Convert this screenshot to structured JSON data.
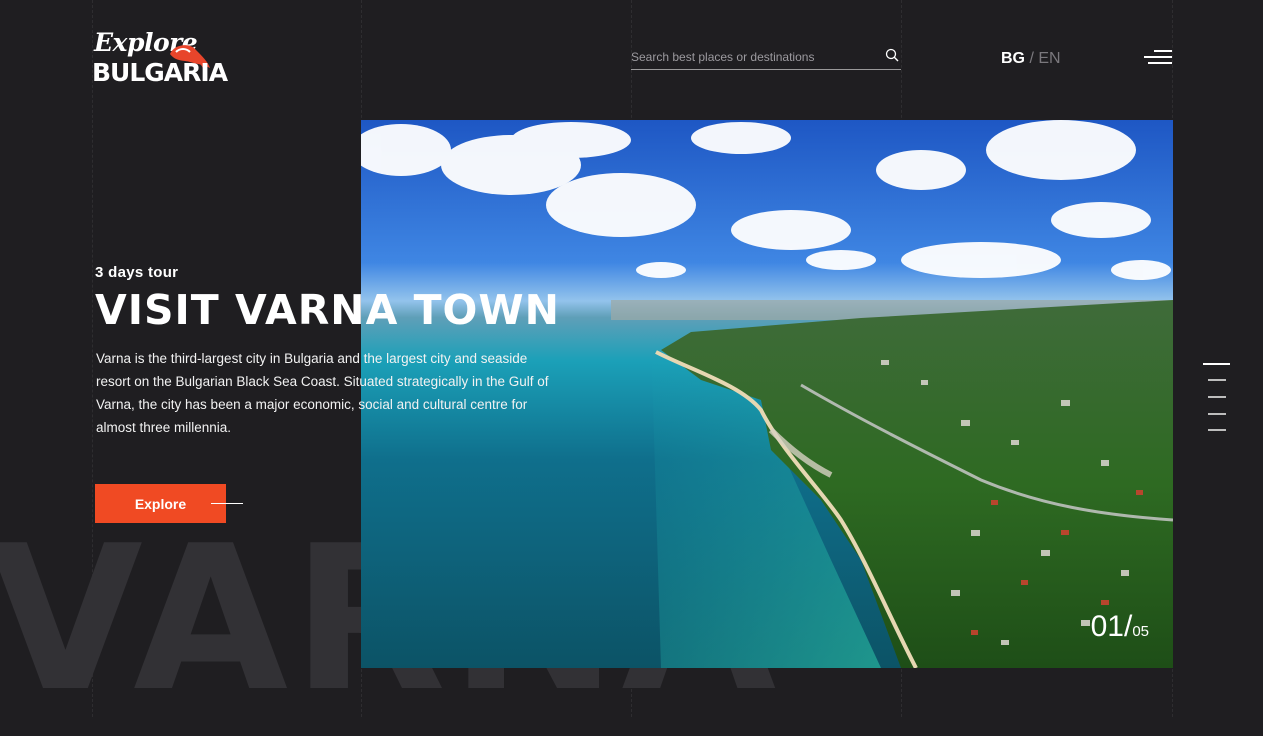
{
  "logo": {
    "line1": "Explore",
    "line2": "BULGARIA"
  },
  "search": {
    "placeholder": "Search best places or destinations",
    "icon": "search-icon"
  },
  "language": {
    "active": "BG",
    "separator": "/",
    "inactive": "EN"
  },
  "menu": {
    "icon": "hamburger-menu-icon"
  },
  "hero": {
    "subtitle": "3 days tour",
    "title": "VISIT VARNA TOWN",
    "description": "Varna is the third-largest city in Bulgaria and the largest city and seaside resort on the Bulgarian Black Sea Coast. Situated strategically in the Gulf of Varna, the city has been a major economic, social and cultural centre for almost three millennia.",
    "button_label": "Explore",
    "background_word": "VARNA"
  },
  "slider": {
    "current": "01/",
    "total": "05",
    "active_index": 1,
    "count": 5
  },
  "colors": {
    "accent": "#f04a23",
    "background": "#1f1e21",
    "watermark": "#323135"
  }
}
